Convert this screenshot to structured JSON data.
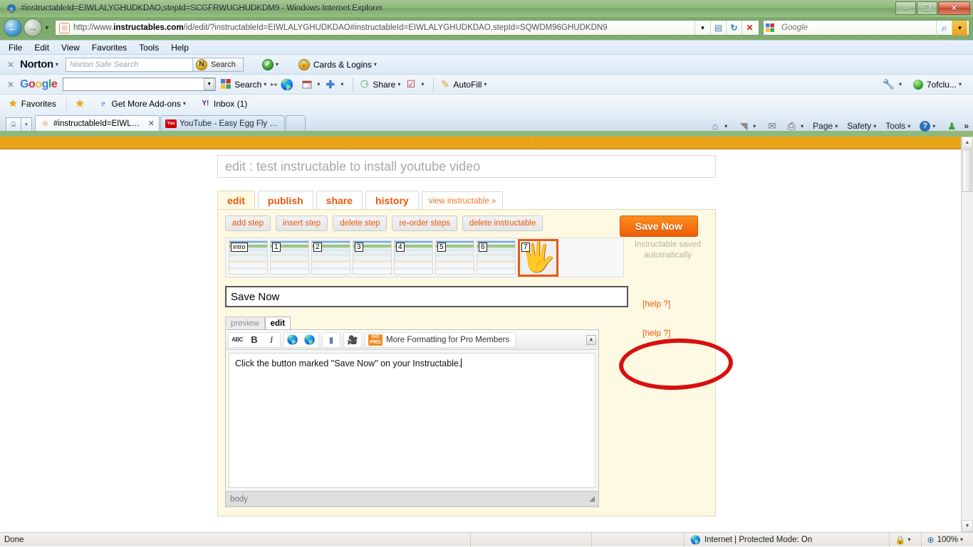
{
  "window": {
    "title": "#instructableId=EIWLALYGHUDKDAO,stepId=SCGFRWUGHUDKDM9 - Windows Internet Explorer",
    "minimize_label": "–",
    "restore_label": "❐",
    "close_label": "✕"
  },
  "address": {
    "url_prefix": "http://www.",
    "url_domain": "instructables.com",
    "url_rest": "/id/edit/?instructableId=EIWLALYGHUDKDAO#instructableId=EIWLALYGHUDKDAO,stepId=SQWDM96GHUDKDN9",
    "back_glyph": "←",
    "forward_glyph": "→",
    "dropdown_glyph": "▼",
    "compat_glyph": "▤",
    "refresh_glyph": "↻",
    "stop_glyph": "✕",
    "search_placeholder": "Google",
    "search_glyph": "⌕",
    "search_dd_glyph": "▼"
  },
  "menubar": {
    "items": [
      "File",
      "Edit",
      "View",
      "Favorites",
      "Tools",
      "Help"
    ]
  },
  "norton_toolbar": {
    "close_glyph": "✕",
    "brand": "Norton",
    "brand_caret": "▾",
    "search_placeholder": "Norton Safe Search",
    "search_button": "Search",
    "search_icon": "N",
    "check_icon": "✓",
    "check_caret": "▾",
    "lock_icon": "●",
    "cards_label": "Cards & Logins",
    "cards_caret": "▾"
  },
  "google_toolbar": {
    "close_glyph": "✕",
    "brand": "Google",
    "input_value": "",
    "input_caret": "▼",
    "search_label": "Search",
    "search_caret": "▾",
    "nav_caret": "▸◂",
    "globe_icon": "●",
    "bookmark_caret": "▾",
    "plus_icon": "✚",
    "plus_caret": "▾",
    "share_label": "Share",
    "share_caret": "▾",
    "highlight_caret": "▾",
    "autofill_label": "AutoFill",
    "autofill_caret": "▾",
    "wrench_caret": "▾",
    "account_label": "7ofclu...",
    "account_caret": "▾"
  },
  "favorites_bar": {
    "favorites_label": "Favorites",
    "add_ons_label": "Get More Add-ons",
    "add_ons_caret": "▾",
    "inbox_label": "Inbox (1)",
    "yahoo_icon": "Y!"
  },
  "tabs": {
    "grid_glyph": "⌸",
    "grid_caret": "▾",
    "items": [
      {
        "label": "#instructableId=EIWLA...",
        "active": true,
        "close": "✕",
        "icon": "◎"
      },
      {
        "label": "YouTube - Easy Egg Fly Pa...",
        "active": false,
        "close": "",
        "icon": "You"
      }
    ]
  },
  "command_bar": {
    "items": [
      {
        "name": "home",
        "glyph": "⌂",
        "label": "",
        "caret": "▾"
      },
      {
        "name": "feeds",
        "glyph": "◥",
        "label": "",
        "caret": "▾"
      },
      {
        "name": "mail",
        "glyph": "✉",
        "label": "",
        "caret": ""
      },
      {
        "name": "print",
        "glyph": "⎙",
        "label": "",
        "caret": "▾"
      },
      {
        "name": "page",
        "glyph": "",
        "label": "Page",
        "caret": "▾"
      },
      {
        "name": "safety",
        "glyph": "",
        "label": "Safety",
        "caret": "▾"
      },
      {
        "name": "tools",
        "glyph": "",
        "label": "Tools",
        "caret": "▾"
      },
      {
        "name": "help",
        "glyph": "?",
        "label": "",
        "caret": "▾"
      },
      {
        "name": "messenger",
        "glyph": "♟",
        "label": "",
        "caret": ""
      },
      {
        "name": "overflow",
        "glyph": "»",
        "label": "",
        "caret": ""
      }
    ]
  },
  "page": {
    "title_placeholder": "edit : test instructable to install youtube video",
    "main_tabs": [
      {
        "label": "edit",
        "selected": true,
        "plain": false
      },
      {
        "label": "publish",
        "selected": false,
        "plain": false
      },
      {
        "label": "share",
        "selected": false,
        "plain": false
      },
      {
        "label": "history",
        "selected": false,
        "plain": false
      },
      {
        "label": "view instructable »",
        "selected": false,
        "plain": true
      }
    ],
    "step_buttons": [
      "add step",
      "insert step",
      "delete step",
      "re-order steps",
      "delete instructable"
    ],
    "save_button": "Save Now",
    "save_message": "Instructable saved automatically",
    "thumbnails": [
      {
        "label": "intro",
        "selected": false
      },
      {
        "label": "1",
        "selected": false
      },
      {
        "label": "2",
        "selected": false
      },
      {
        "label": "3",
        "selected": false
      },
      {
        "label": "4",
        "selected": false
      },
      {
        "label": "5",
        "selected": false
      },
      {
        "label": "6",
        "selected": false
      },
      {
        "label": "7",
        "selected": true
      }
    ],
    "step_title_value": "Save Now",
    "help_link_title": "[help ?]",
    "help_link_body": "[help ?]",
    "preview_tab": "preview",
    "edit_tab": "edit",
    "editor_toolbar": {
      "spellcheck_icon": "ABC",
      "bold_label": "B",
      "italic_label": "I",
      "link_icon": "◔",
      "unlink_icon": "◔",
      "eraser_icon": "▱",
      "video_icon": "▥",
      "gopro_line1": "GO",
      "gopro_line2": "PRO",
      "pro_text": "More Formatting for Pro Members",
      "collapse_glyph": "▲"
    },
    "editor_body": "Click the button marked \"Save Now\" on your Instructable.",
    "editor_status": "body",
    "resize_grip": "◢"
  },
  "scrollbar": {
    "up_glyph": "▲",
    "down_glyph": "▼"
  },
  "statusbar": {
    "status": "Done",
    "zone": "Internet | Protected Mode: On",
    "zone_icon": "●",
    "protect_glyph": "⛉",
    "protect_caret": "▾",
    "zoom_glyph": "⊕",
    "zoom_level": "100%",
    "zoom_caret": "▾"
  },
  "colors": {
    "accent_orange": "#e8590c",
    "panel_cream": "#fdf9e2",
    "annotation_red": "#d81010",
    "nav_orange": "#e8a317"
  }
}
